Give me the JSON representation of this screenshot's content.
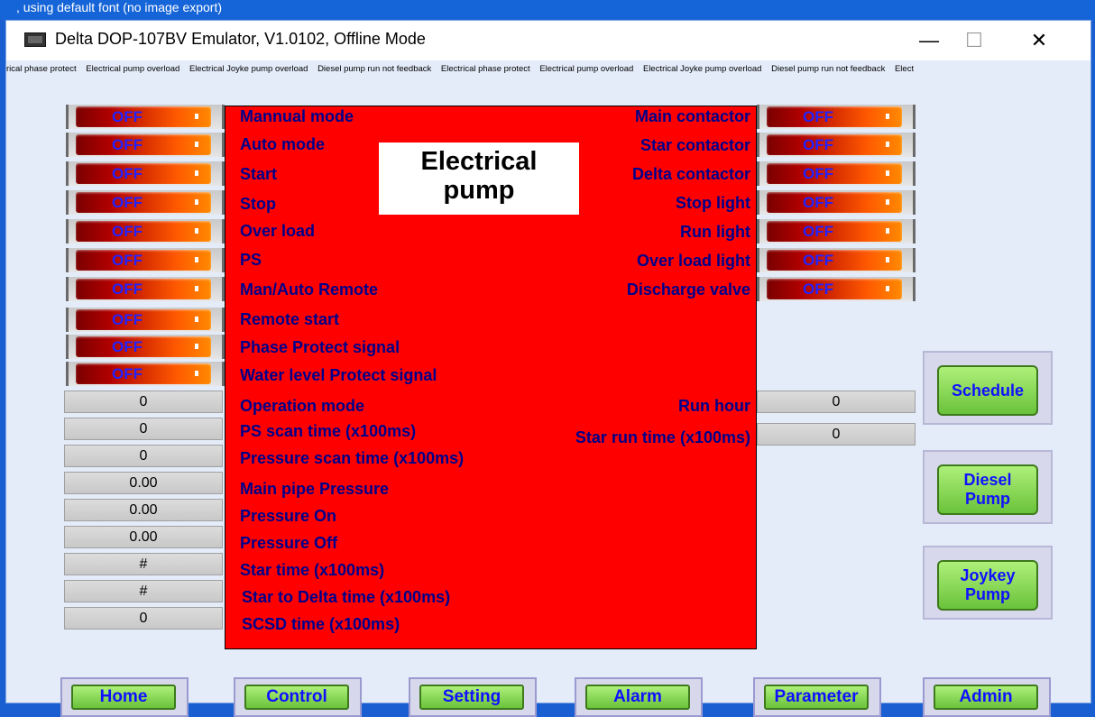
{
  "topstrip": {
    "text": ", using default font (no image export)"
  },
  "window": {
    "title": "Delta DOP-107BV Emulator, V1.0102, Offline Mode",
    "minimize": "—",
    "maximize": "☐",
    "close": "✕"
  },
  "marquee": [
    "rical phase protect",
    "Electrical pump overload",
    "Electrical Joyke pump overload",
    "Diesel pump run not feedback",
    "Electrical phase protect",
    "Electrical pump overload",
    "Electrical Joyke pump overload",
    "Diesel pump run not feedback",
    "Elect"
  ],
  "panel_title": {
    "line1": "Electrical",
    "line2": "pump"
  },
  "left_switches": [
    {
      "label": "Mannual mode",
      "state": "OFF"
    },
    {
      "label": "Auto mode",
      "state": "OFF"
    },
    {
      "label": "Start",
      "state": "OFF"
    },
    {
      "label": "Stop",
      "state": "OFF"
    },
    {
      "label": "Over load",
      "state": "OFF"
    },
    {
      "label": "PS",
      "state": "OFF"
    },
    {
      "label": "Man/Auto Remote",
      "state": "OFF"
    },
    {
      "label": "Remote start",
      "state": "OFF"
    },
    {
      "label": "Phase Protect signal",
      "state": "OFF"
    },
    {
      "label": "Water level Protect signal",
      "state": "OFF"
    }
  ],
  "right_switches": [
    {
      "label": "Main contactor",
      "state": "OFF"
    },
    {
      "label": "Star contactor",
      "state": "OFF"
    },
    {
      "label": "Delta contactor",
      "state": "OFF"
    },
    {
      "label": "Stop light",
      "state": "OFF"
    },
    {
      "label": "Run light",
      "state": "OFF"
    },
    {
      "label": "Over load light",
      "state": "OFF"
    },
    {
      "label": "Discharge valve",
      "state": "OFF"
    }
  ],
  "left_values": [
    {
      "label": "Operation mode",
      "value": "0"
    },
    {
      "label": "PS scan time (x100ms)",
      "value": "0"
    },
    {
      "label": "Pressure scan time (x100ms)",
      "value": "0"
    },
    {
      "label": "Main pipe Pressure",
      "value": "0.00"
    },
    {
      "label": "Pressure On",
      "value": "0.00"
    },
    {
      "label": "Pressure Off",
      "value": "0.00"
    },
    {
      "label": "Star time (x100ms)",
      "value": "#"
    },
    {
      "label": "Star to Delta time (x100ms)",
      "value": "#"
    },
    {
      "label": "SCSD time (x100ms)",
      "value": "0"
    }
  ],
  "right_values": [
    {
      "label": "Run hour",
      "value": "0"
    },
    {
      "label": "Star run time (x100ms)",
      "value": "0"
    }
  ],
  "side_buttons": {
    "schedule": "Schedule",
    "diesel_1": "Diesel",
    "diesel_2": "Pump",
    "joykey_1": "Joykey",
    "joykey_2": "Pump"
  },
  "nav": {
    "home": "Home",
    "control": "Control",
    "setting": "Setting",
    "alarm": "Alarm",
    "parameter": "Parameter",
    "admin": "Admin"
  },
  "colors": {
    "panel": "#ff0000",
    "label": "#00008b",
    "button_text": "#1010ff",
    "button_green": "#8ad85a"
  }
}
